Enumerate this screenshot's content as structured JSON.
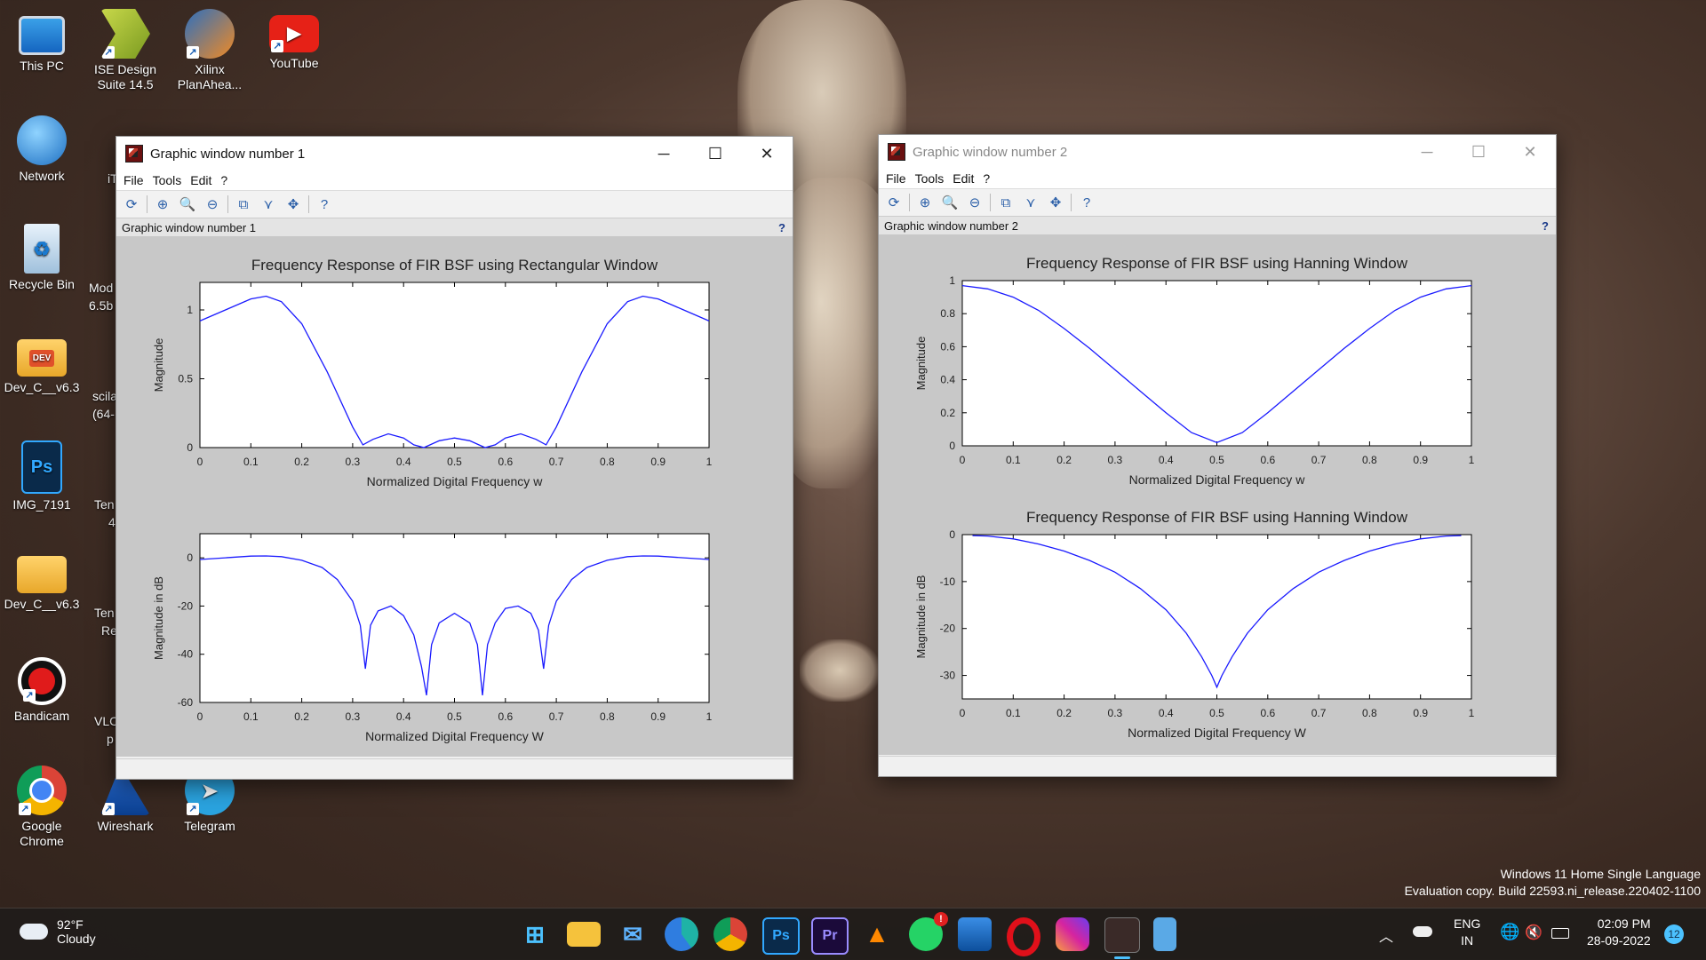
{
  "desktop": {
    "icons": [
      {
        "label": "This PC",
        "icon": "monitor-icon"
      },
      {
        "label": "ISE Design Suite 14.5",
        "icon": "ise-design-icon"
      },
      {
        "label": "Xilinx PlanAhea...",
        "icon": "xilinx-planahead-icon"
      },
      {
        "label": "YouTube",
        "icon": "youtube-icon"
      },
      {
        "label": "Network",
        "icon": "network-globe-icon"
      },
      {
        "label": "Recycle Bin",
        "icon": "recycle-bin-icon"
      },
      {
        "label": "Dev_C__v6.3",
        "icon": "folder-dev-icon"
      },
      {
        "label": "IMG_7191",
        "icon": "photoshop-psd-icon"
      },
      {
        "label": "Dev_C__v6.3",
        "icon": "zip-folder-icon"
      },
      {
        "label": "Bandicam",
        "icon": "bandicam-record-icon"
      },
      {
        "label": "Google Chrome",
        "icon": "chrome-icon"
      },
      {
        "label": "Wireshark",
        "icon": "wireshark-fin-icon"
      },
      {
        "label": "Telegram",
        "icon": "telegram-icon"
      }
    ],
    "partial_labels": [
      "iT",
      "Mod",
      "6.5b",
      "scila",
      "(64-",
      "Ten",
      "4",
      "Ten",
      "Re",
      "VLC",
      "p"
    ]
  },
  "windows": [
    {
      "title": "Graphic window number 1",
      "menu": [
        "File",
        "Tools",
        "Edit",
        "?"
      ],
      "info_label": "Graphic window number 1",
      "help": "?",
      "controls": {
        "minimize": "─",
        "maximize": "☐",
        "close": "✕"
      }
    },
    {
      "title": "Graphic window number 2",
      "menu": [
        "File",
        "Tools",
        "Edit",
        "?"
      ],
      "info_label": "Graphic window number 2",
      "help": "?",
      "controls": {
        "minimize": "─",
        "maximize": "☐",
        "close": "✕"
      }
    }
  ],
  "chart_data": [
    {
      "type": "line",
      "title": "Frequency Response of FIR BSF using Rectangular Window",
      "xlabel": "Normalized Digital Frequency w",
      "ylabel": "Magnitude",
      "xlim": [
        0,
        1
      ],
      "ylim": [
        0,
        1.2
      ],
      "xticks": [
        "0",
        "0.1",
        "0.2",
        "0.3",
        "0.4",
        "0.5",
        "0.6",
        "0.7",
        "0.8",
        "0.9",
        "1"
      ],
      "yticks": [
        {
          "v": 0,
          "t": "0"
        },
        {
          "v": 0.5,
          "t": "0.5"
        },
        {
          "v": 1,
          "t": "1"
        }
      ],
      "series": [
        {
          "x": [
            0,
            0.05,
            0.1,
            0.13,
            0.16,
            0.2,
            0.25,
            0.3,
            0.32,
            0.34,
            0.37,
            0.4,
            0.42,
            0.44,
            0.47,
            0.5,
            0.53,
            0.56,
            0.58,
            0.6,
            0.63,
            0.66,
            0.68,
            0.7,
            0.75,
            0.8,
            0.84,
            0.87,
            0.9,
            0.95,
            1
          ],
          "y": [
            0.92,
            1.0,
            1.08,
            1.1,
            1.06,
            0.9,
            0.55,
            0.15,
            0.02,
            0.06,
            0.1,
            0.07,
            0.02,
            0.0,
            0.05,
            0.07,
            0.05,
            0.0,
            0.02,
            0.07,
            0.1,
            0.06,
            0.02,
            0.15,
            0.55,
            0.9,
            1.06,
            1.1,
            1.08,
            1.0,
            0.92
          ],
          "color": "#1a1aff"
        }
      ]
    },
    {
      "type": "line",
      "title": "",
      "xlabel": "Normalized Digital Frequency W",
      "ylabel": "Magnitude in dB",
      "xlim": [
        0,
        1
      ],
      "ylim": [
        -60,
        10
      ],
      "xticks": [
        "0",
        "0.1",
        "0.2",
        "0.3",
        "0.4",
        "0.5",
        "0.6",
        "0.7",
        "0.8",
        "0.9",
        "1"
      ],
      "yticks": [
        {
          "v": -60,
          "t": "-60"
        },
        {
          "v": -40,
          "t": "-40"
        },
        {
          "v": -20,
          "t": "-20"
        },
        {
          "v": 0,
          "t": "0"
        }
      ],
      "series": [
        {
          "x": [
            0,
            0.05,
            0.1,
            0.13,
            0.16,
            0.2,
            0.24,
            0.27,
            0.3,
            0.315,
            0.325,
            0.335,
            0.35,
            0.375,
            0.4,
            0.42,
            0.435,
            0.445,
            0.455,
            0.47,
            0.5,
            0.53,
            0.545,
            0.555,
            0.565,
            0.58,
            0.6,
            0.625,
            0.65,
            0.665,
            0.675,
            0.685,
            0.7,
            0.73,
            0.76,
            0.8,
            0.84,
            0.87,
            0.9,
            0.95,
            1
          ],
          "y": [
            -0.7,
            0,
            0.7,
            0.8,
            0.5,
            -1,
            -4,
            -9,
            -18,
            -28,
            -46,
            -28,
            -22,
            -20,
            -24,
            -32,
            -45,
            -57,
            -36,
            -27,
            -23,
            -27,
            -36,
            -57,
            -36,
            -27,
            -21,
            -20,
            -23,
            -30,
            -46,
            -28,
            -18,
            -9,
            -4,
            -1,
            0.5,
            0.8,
            0.7,
            0,
            -0.7
          ],
          "color": "#1a1aff"
        }
      ]
    },
    {
      "type": "line",
      "title": "Frequency Response of FIR BSF using Hanning Window",
      "xlabel": "Normalized Digital Frequency w",
      "ylabel": "Magnitude",
      "xlim": [
        0,
        1
      ],
      "ylim": [
        0,
        1
      ],
      "xticks": [
        "0",
        "0.1",
        "0.2",
        "0.3",
        "0.4",
        "0.5",
        "0.6",
        "0.7",
        "0.8",
        "0.9",
        "1"
      ],
      "yticks": [
        {
          "v": 0,
          "t": "0"
        },
        {
          "v": 0.2,
          "t": "0.2"
        },
        {
          "v": 0.4,
          "t": "0.4"
        },
        {
          "v": 0.6,
          "t": "0.6"
        },
        {
          "v": 0.8,
          "t": "0.8"
        },
        {
          "v": 1,
          "t": "1"
        }
      ],
      "series": [
        {
          "x": [
            0,
            0.05,
            0.1,
            0.15,
            0.2,
            0.25,
            0.3,
            0.35,
            0.4,
            0.45,
            0.5,
            0.55,
            0.6,
            0.65,
            0.7,
            0.75,
            0.8,
            0.85,
            0.9,
            0.95,
            1
          ],
          "y": [
            0.97,
            0.95,
            0.9,
            0.82,
            0.71,
            0.59,
            0.46,
            0.33,
            0.2,
            0.08,
            0.02,
            0.08,
            0.2,
            0.33,
            0.46,
            0.59,
            0.71,
            0.82,
            0.9,
            0.95,
            0.97
          ],
          "color": "#1a1aff"
        }
      ]
    },
    {
      "type": "line",
      "title": "Frequency Response of FIR BSF using Hanning Window",
      "xlabel": "Normalized Digital Frequency W",
      "ylabel": "Magnitude in dB",
      "xlim": [
        0,
        1
      ],
      "ylim": [
        -35,
        0
      ],
      "xticks": [
        "0",
        "0.1",
        "0.2",
        "0.3",
        "0.4",
        "0.5",
        "0.6",
        "0.7",
        "0.8",
        "0.9",
        "1"
      ],
      "yticks": [
        {
          "v": -30,
          "t": "-30"
        },
        {
          "v": -20,
          "t": "-20"
        },
        {
          "v": -10,
          "t": "-10"
        },
        {
          "v": 0,
          "t": "0"
        }
      ],
      "series": [
        {
          "x": [
            0.02,
            0.05,
            0.1,
            0.15,
            0.2,
            0.25,
            0.3,
            0.35,
            0.4,
            0.44,
            0.47,
            0.49,
            0.5,
            0.51,
            0.53,
            0.56,
            0.6,
            0.65,
            0.7,
            0.75,
            0.8,
            0.85,
            0.9,
            0.95,
            0.98
          ],
          "y": [
            -0.2,
            -0.3,
            -0.9,
            -2,
            -3.5,
            -5.5,
            -8,
            -11.5,
            -16,
            -21,
            -26,
            -30,
            -32.5,
            -30,
            -26,
            -21,
            -16,
            -11.5,
            -8,
            -5.5,
            -3.5,
            -2,
            -0.9,
            -0.3,
            -0.2
          ],
          "color": "#1a1aff"
        }
      ]
    }
  ],
  "watermark": {
    "line1": "Windows 11 Home Single Language",
    "line2": "Evaluation copy. Build 22593.ni_release.220402-1100"
  },
  "taskbar": {
    "weather": {
      "temp": "92°F",
      "condition": "Cloudy"
    },
    "apps": [
      "windows-start-icon",
      "file-explorer-icon",
      "mail-icon",
      "edge-icon",
      "chrome-icon",
      "photoshop-icon",
      "premiere-icon",
      "vlc-icon",
      "whatsapp-icon",
      "photos-icon",
      "opera-icon",
      "instagram-icon",
      "scilab-icon",
      "notepad-icon"
    ],
    "whatsapp_badge": "!",
    "lang": "ENG",
    "region": "IN",
    "time": "02:09 PM",
    "date": "28-09-2022",
    "notif_count": "12"
  }
}
